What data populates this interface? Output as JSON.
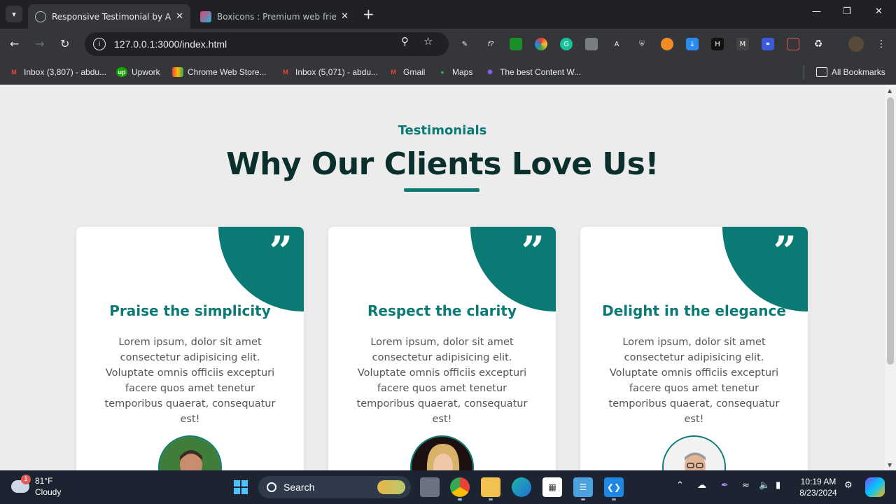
{
  "browser": {
    "tabs": [
      {
        "title": "Responsive Testimonial by Abdu",
        "active": true
      },
      {
        "title": "Boxicons : Premium web friendl",
        "active": false
      }
    ],
    "url": "127.0.0.1:3000/index.html",
    "bookmarks": [
      {
        "label": "Inbox (3,807) - abdu...",
        "icon": "gmail-icon"
      },
      {
        "label": "Upwork",
        "icon": "upwork-icon"
      },
      {
        "label": "Chrome Web Store...",
        "icon": "chrome-web-store-icon"
      },
      {
        "label": "Inbox (5,071) - abdu...",
        "icon": "gmail-icon"
      },
      {
        "label": "Gmail",
        "icon": "gmail-icon"
      },
      {
        "label": "Maps",
        "icon": "maps-icon"
      },
      {
        "label": "The best Content W...",
        "icon": "content-writer-icon"
      }
    ],
    "all_bookmarks_label": "All Bookmarks"
  },
  "page": {
    "eyebrow": "Testimonials",
    "heading": "Why Our Clients Love Us!",
    "cards": [
      {
        "title": "Praise the simplicity",
        "text": "Lorem ipsum, dolor sit amet consectetur adipisicing elit. Voluptate omnis officiis excepturi facere quos amet tenetur temporibus quaerat, consequatur est!"
      },
      {
        "title": "Respect the clarity",
        "text": "Lorem ipsum, dolor sit amet consectetur adipisicing elit. Voluptate omnis officiis excepturi facere quos amet tenetur temporibus quaerat, consequatur est!"
      },
      {
        "title": "Delight in the elegance",
        "text": "Lorem ipsum, dolor sit amet consectetur adipisicing elit. Voluptate omnis officiis excepturi facere quos amet tenetur temporibus quaerat, consequatur est!"
      }
    ]
  },
  "taskbar": {
    "weather_temp": "81°F",
    "weather_desc": "Cloudy",
    "weather_badge": "1",
    "search_label": "Search",
    "time": "10:19 AM",
    "date": "8/23/2024"
  },
  "colors": {
    "accent": "#0b7a75",
    "heading": "#0a2f2d",
    "page_bg": "#ececec"
  }
}
